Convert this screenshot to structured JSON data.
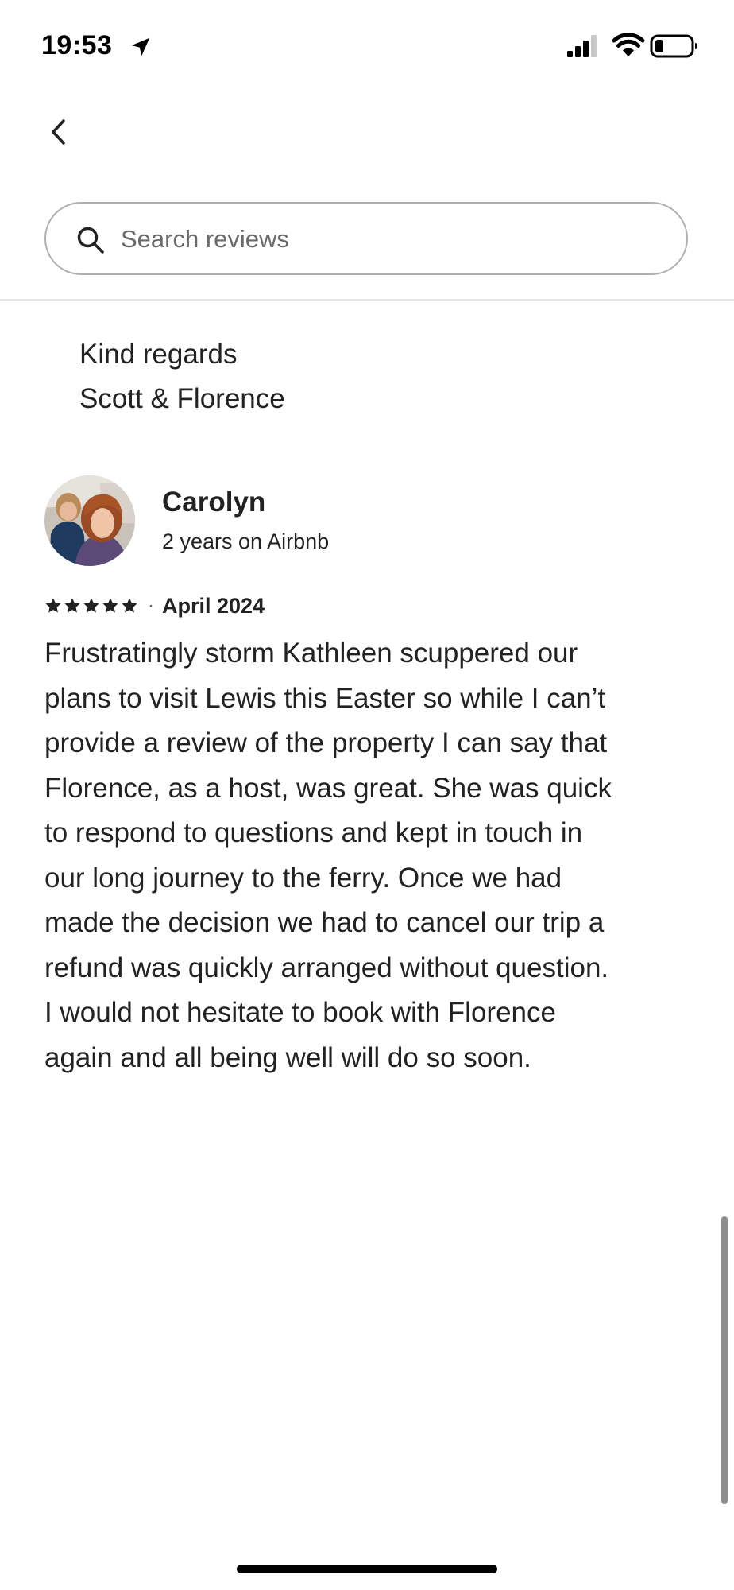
{
  "status_bar": {
    "time": "19:53",
    "icons": [
      "location-arrow-icon",
      "cellular-signal-icon",
      "wifi-icon",
      "battery-icon"
    ]
  },
  "nav": {
    "back_icon": "chevron-left-icon"
  },
  "search": {
    "placeholder": "Search reviews",
    "value": "",
    "icon": "search-icon"
  },
  "previous_review": {
    "lines": [
      "Kind regards",
      "Scott & Florence"
    ]
  },
  "review": {
    "reviewer_name": "Carolyn",
    "reviewer_tenure": "2 years on Airbnb",
    "rating": 5,
    "rating_max": 5,
    "separator": "·",
    "date": "April 2024",
    "body_lines": [
      "Frustratingly storm Kathleen scuppered our",
      "plans to visit Lewis this Easter so while I can’t",
      "provide a review of the property I can say that",
      "Florence, as a host, was great. She was quick",
      "to respond to questions and kept in touch in",
      "our long journey to the ferry. Once we had",
      "made the decision we had to cancel our trip a",
      "refund was quickly arranged without question.",
      "I would not hesitate to book with Florence",
      "again and all being well will do so soon."
    ]
  },
  "colors": {
    "text": "#222222",
    "secondary_text": "#6a6a6a",
    "border": "#b0b0b0",
    "divider": "#e6e6e6"
  }
}
